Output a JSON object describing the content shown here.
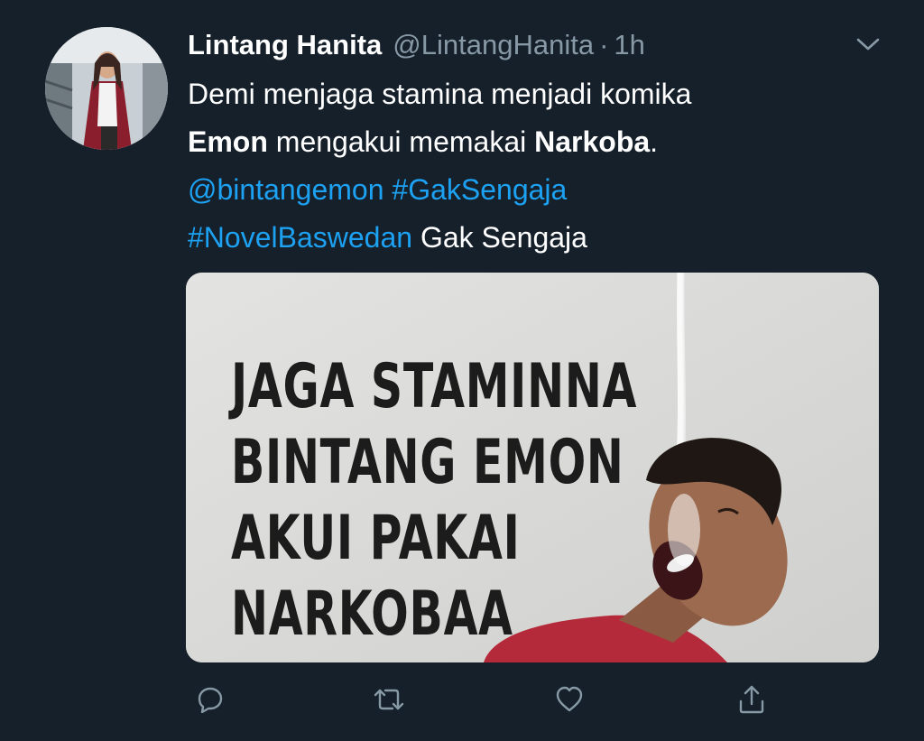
{
  "tweet": {
    "author_name": "Lintang Hanita",
    "author_handle": "@LintangHanita",
    "separator": "·",
    "timestamp": "1h",
    "text": {
      "line1": "Demi menjaga stamina menjadi komika",
      "line2_bold1": "Emon",
      "line2_mid": " mengakui memakai ",
      "line2_bold2": "Narkoba",
      "line2_end": ".",
      "line3_mention": "@bintangemon",
      "line3_hashtag": "#GakSengaja",
      "line4_hashtag": "#NovelBaswedan",
      "line4_end": " Gak Sengaja"
    },
    "media": {
      "headline": [
        "JAGA STAMINNA",
        "BINTANG EMON",
        "AKUI PAKAI",
        "NARKOBAA"
      ]
    }
  },
  "icons": {
    "menu": "chevron-down-icon",
    "reply": "reply-icon",
    "retweet": "retweet-icon",
    "like": "heart-icon",
    "share": "share-icon"
  },
  "colors": {
    "background": "#15202b",
    "link": "#1da1f2",
    "muted": "#8899a6",
    "text": "#ffffff"
  }
}
